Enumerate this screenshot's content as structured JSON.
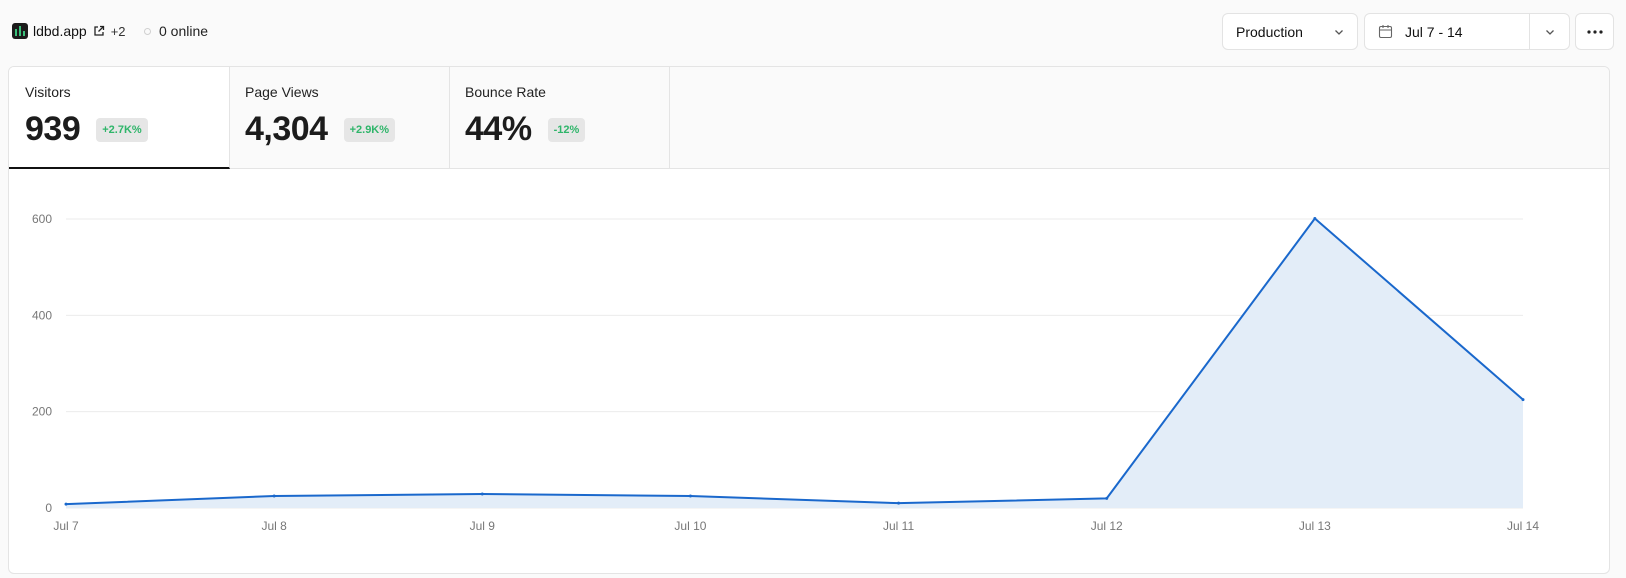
{
  "header": {
    "project_name": "ldbd.app",
    "extra_count": "+2",
    "online_text": "0 online",
    "environment": "Production",
    "date_range": "Jul 7 - 14"
  },
  "stats": [
    {
      "label": "Visitors",
      "value": "939",
      "change": "+2.7K%",
      "change_color": "#2fb56a",
      "active": true
    },
    {
      "label": "Page Views",
      "value": "4,304",
      "change": "+2.9K%",
      "change_color": "#2fb56a",
      "active": false
    },
    {
      "label": "Bounce Rate",
      "value": "44%",
      "change": "-12%",
      "change_color": "#2fb56a",
      "active": false
    }
  ],
  "colors": {
    "line": "#1a68cc",
    "area": "#e3edf8",
    "grid": "#ebebeb"
  },
  "chart_data": {
    "type": "area",
    "categories": [
      "Jul 7",
      "Jul 8",
      "Jul 9",
      "Jul 10",
      "Jul 11",
      "Jul 12",
      "Jul 13",
      "Jul 14"
    ],
    "values": [
      8,
      25,
      29,
      25,
      10,
      20,
      601,
      225
    ],
    "y_ticks": [
      0,
      200,
      400,
      600
    ],
    "ylim": [
      0,
      600
    ],
    "grid": true
  }
}
